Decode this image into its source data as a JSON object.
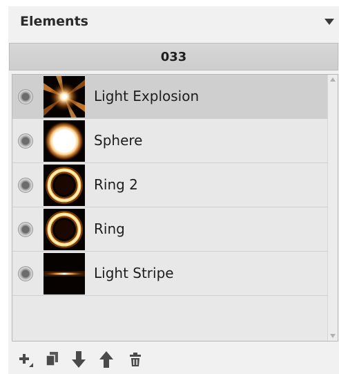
{
  "panel": {
    "title": "Elements",
    "menu_icon": "triangle-down-icon",
    "group_name": "033"
  },
  "elements": [
    {
      "label": "Light Explosion",
      "thumbnail": "light-explosion-thumbnail",
      "visible_icon": "eye-icon",
      "selected": true
    },
    {
      "label": "Sphere",
      "thumbnail": "sphere-thumbnail",
      "visible_icon": "eye-icon",
      "selected": false
    },
    {
      "label": "Ring 2",
      "thumbnail": "ring-thumbnail",
      "visible_icon": "eye-icon",
      "selected": false
    },
    {
      "label": "Ring",
      "thumbnail": "ring-thumbnail",
      "visible_icon": "eye-icon",
      "selected": false
    },
    {
      "label": "Light Stripe",
      "thumbnail": "light-stripe-thumbnail",
      "visible_icon": "eye-icon",
      "selected": false
    }
  ],
  "toolbar": {
    "add": "add-icon",
    "duplicate": "duplicate-icon",
    "move_down": "arrow-down-icon",
    "move_up": "arrow-up-icon",
    "delete": "trash-icon"
  },
  "colors": {
    "selected_row": "#cfcfcf",
    "glow": "#ffb347"
  }
}
